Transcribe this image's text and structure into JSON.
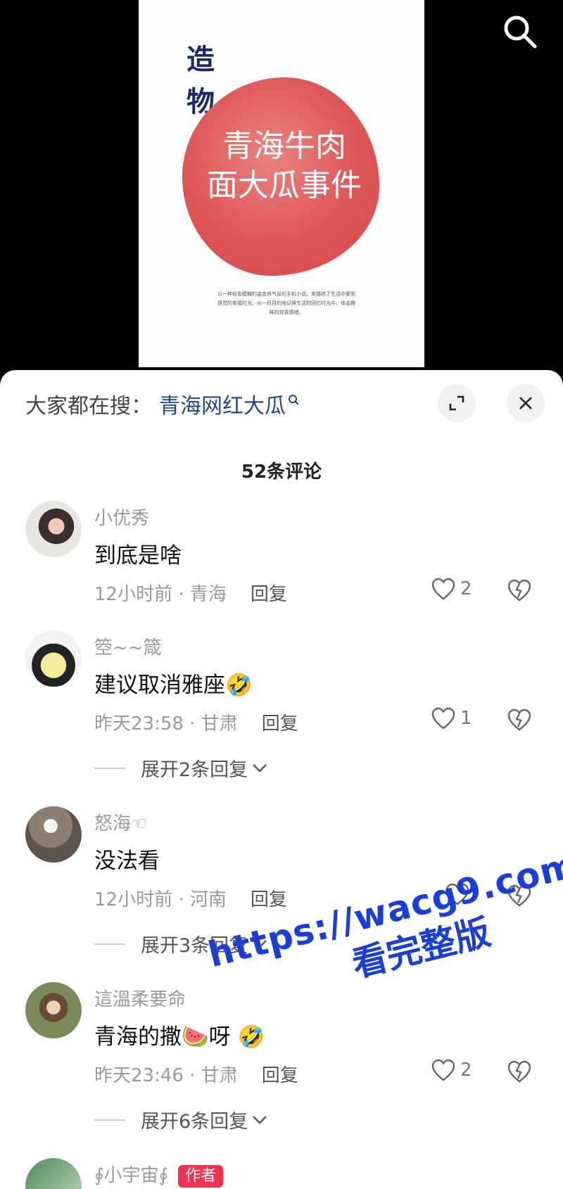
{
  "video": {
    "poster_title": "造物",
    "poster_headline_line1": "青海牛肉",
    "poster_headline_line2": "面大瓜事件",
    "poster_small_text": "以一种轻盈模糊的姿态将气息的手机小说，来描述了生活中爱到感觉的幸福时光，从一段目的地记得生活的回忆时光中，体会趣味的欢喜情绪。",
    "search_icon": "search-icon"
  },
  "sheet": {
    "suggest_label": "大家都在搜：",
    "suggest_keyword": "青海网红大瓜",
    "expand_icon": "expand-icon",
    "close_icon": "close-icon",
    "comment_count": "52条评论"
  },
  "comments": [
    {
      "name": "小优秀",
      "text": "到底是啥",
      "time_loc": "12小时前 · 青海",
      "reply": "回复",
      "likes": "2",
      "expand": ""
    },
    {
      "name": "箜~~箴",
      "text": "建议取消雅座🤣",
      "time_loc": "昨天23:58 · 甘肃",
      "reply": "回复",
      "likes": "1",
      "expand": "展开2条回复"
    },
    {
      "name": "怒海☜",
      "text": "没法看",
      "time_loc": "12小时前 · 河南",
      "reply": "回复",
      "likes": "",
      "expand": "展开3条回复"
    },
    {
      "name": "這溫柔要命",
      "text": "青海的撒🍉呀 🤣",
      "time_loc": "昨天23:46 · 甘肃",
      "reply": "回复",
      "likes": "2",
      "expand": "展开6条回复"
    },
    {
      "name": "∮小宇宙∮",
      "badge": "作者"
    }
  ],
  "watermark": {
    "line1": "https://wacg9.com",
    "line2": "看完整版"
  },
  "colors": {
    "keyword_blue": "#1d4a88",
    "author_badge_red": "#f0324e",
    "watermark_blue": "#1b3fd6",
    "poster_red": "#dd5656"
  }
}
